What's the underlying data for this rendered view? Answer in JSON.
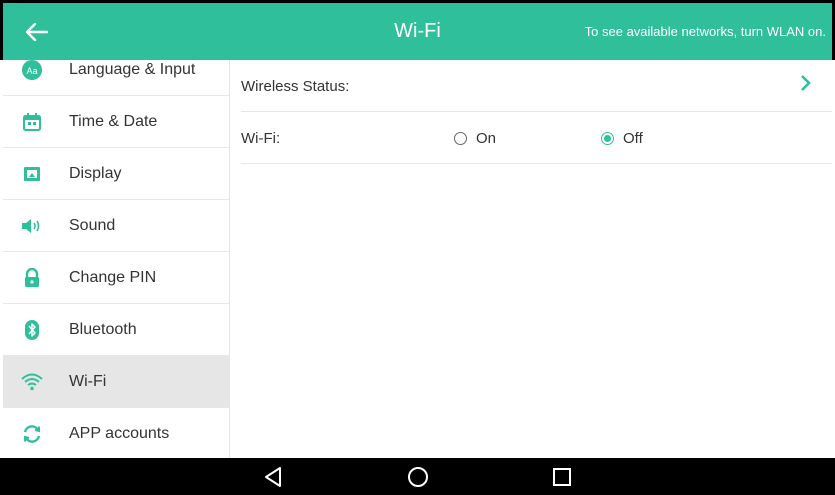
{
  "header": {
    "title": "Wi-Fi",
    "hint": "To see available networks, turn WLAN on.",
    "back_icon": "arrow-left-icon"
  },
  "sidebar": {
    "items": [
      {
        "label": "Language & Input",
        "icon": "language-input-icon"
      },
      {
        "label": "Time & Date",
        "icon": "calendar-icon"
      },
      {
        "label": "Display",
        "icon": "display-icon"
      },
      {
        "label": "Sound",
        "icon": "speaker-icon"
      },
      {
        "label": "Change PIN",
        "icon": "lock-icon"
      },
      {
        "label": "Bluetooth",
        "icon": "bluetooth-icon"
      },
      {
        "label": "Wi-Fi",
        "icon": "wifi-icon",
        "active": true
      },
      {
        "label": "APP accounts",
        "icon": "sync-icon"
      }
    ]
  },
  "main": {
    "wireless_status_label": "Wireless Status:",
    "wifi_label": "Wi-Fi:",
    "wifi_options": [
      {
        "label": "On",
        "checked": false
      },
      {
        "label": "Off",
        "checked": true
      }
    ]
  },
  "colors": {
    "accent": "#2fbf9b",
    "active_bg": "#e6e6e6",
    "nav_bg": "#000000"
  },
  "navbar": {
    "buttons": [
      "back-triangle-icon",
      "home-circle-icon",
      "recents-square-icon"
    ]
  }
}
